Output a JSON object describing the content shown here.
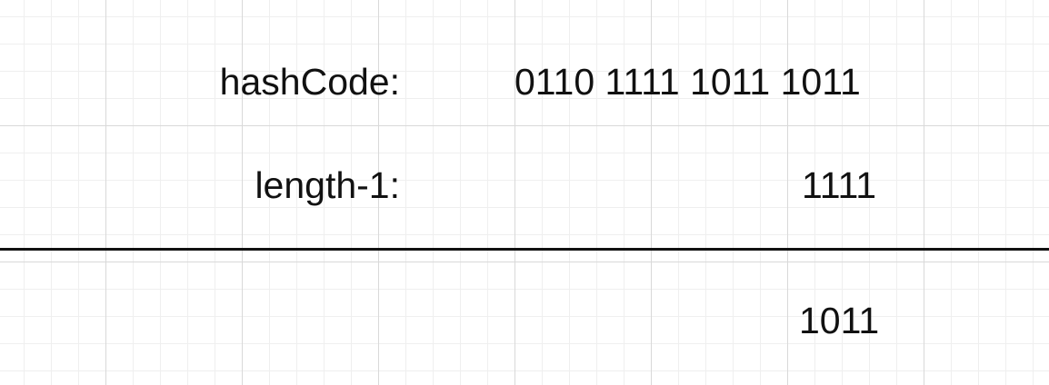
{
  "rows": {
    "hashcode": {
      "label": "hashCode:",
      "value": "0110 1111 1011 1011"
    },
    "length_minus_one": {
      "label": "length-1:",
      "value": "1111"
    },
    "result": {
      "value": "1011"
    }
  }
}
